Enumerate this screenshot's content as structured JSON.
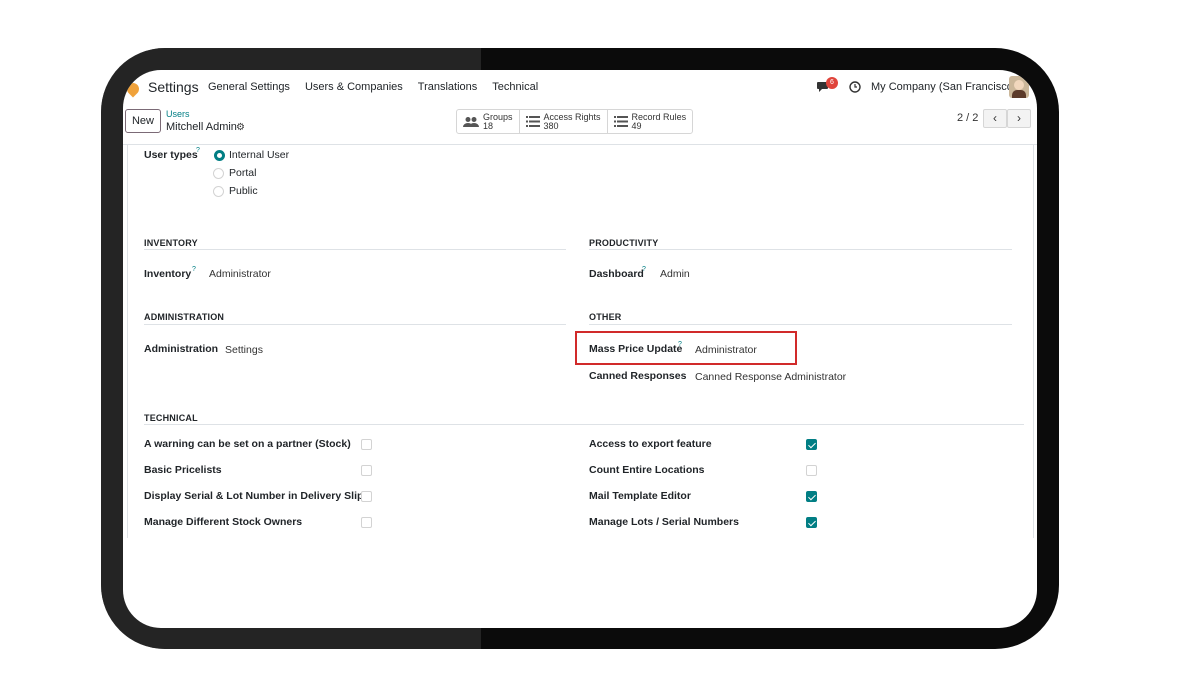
{
  "app": {
    "title": "Settings",
    "menu": [
      "General Settings",
      "Users & Companies",
      "Translations",
      "Technical"
    ]
  },
  "systray": {
    "chat_count": "6",
    "company": "My Company (San Francisco)"
  },
  "control": {
    "new_label": "New",
    "breadcrumb_parent": "Users",
    "breadcrumb_current": "Mitchell Admin",
    "stats": [
      {
        "label": "Groups",
        "count": "18",
        "icon": "users-icon"
      },
      {
        "label": "Access Rights",
        "count": "380",
        "icon": "list-icon"
      },
      {
        "label": "Record Rules",
        "count": "49",
        "icon": "list-icon"
      }
    ],
    "pager": "2 / 2"
  },
  "user_types": {
    "label": "User types",
    "help": "?",
    "options": [
      "Internal User",
      "Portal",
      "Public"
    ],
    "selected": "Internal User"
  },
  "inventory": {
    "heading": "INVENTORY",
    "field_label": "Inventory",
    "help": "?",
    "value": "Administrator"
  },
  "productivity": {
    "heading": "PRODUCTIVITY",
    "field_label": "Dashboard",
    "help": "?",
    "value": "Admin"
  },
  "administration": {
    "heading": "ADMINISTRATION",
    "field_label": "Administration",
    "value": "Settings"
  },
  "other": {
    "heading": "OTHER",
    "mass_price_label": "Mass Price Update",
    "help": "?",
    "mass_price_value": "Administrator",
    "canned_label": "Canned Responses",
    "canned_value": "Canned Response Administrator"
  },
  "technical": {
    "heading": "TECHNICAL",
    "left": [
      {
        "label": "A warning can be set on a partner (Stock)",
        "checked": false
      },
      {
        "label": "Basic Pricelists",
        "checked": false
      },
      {
        "label": "Display Serial & Lot Number in Delivery Slips",
        "checked": false
      },
      {
        "label": "Manage Different Stock Owners",
        "checked": false
      }
    ],
    "right": [
      {
        "label": "Access to export feature",
        "checked": true
      },
      {
        "label": "Count Entire Locations",
        "checked": false
      },
      {
        "label": "Mail Template Editor",
        "checked": true
      },
      {
        "label": "Manage Lots / Serial Numbers",
        "checked": true
      }
    ]
  },
  "colors": {
    "accent": "#017e84",
    "highlight": "#d12a2a",
    "badge": "#e0443b"
  }
}
